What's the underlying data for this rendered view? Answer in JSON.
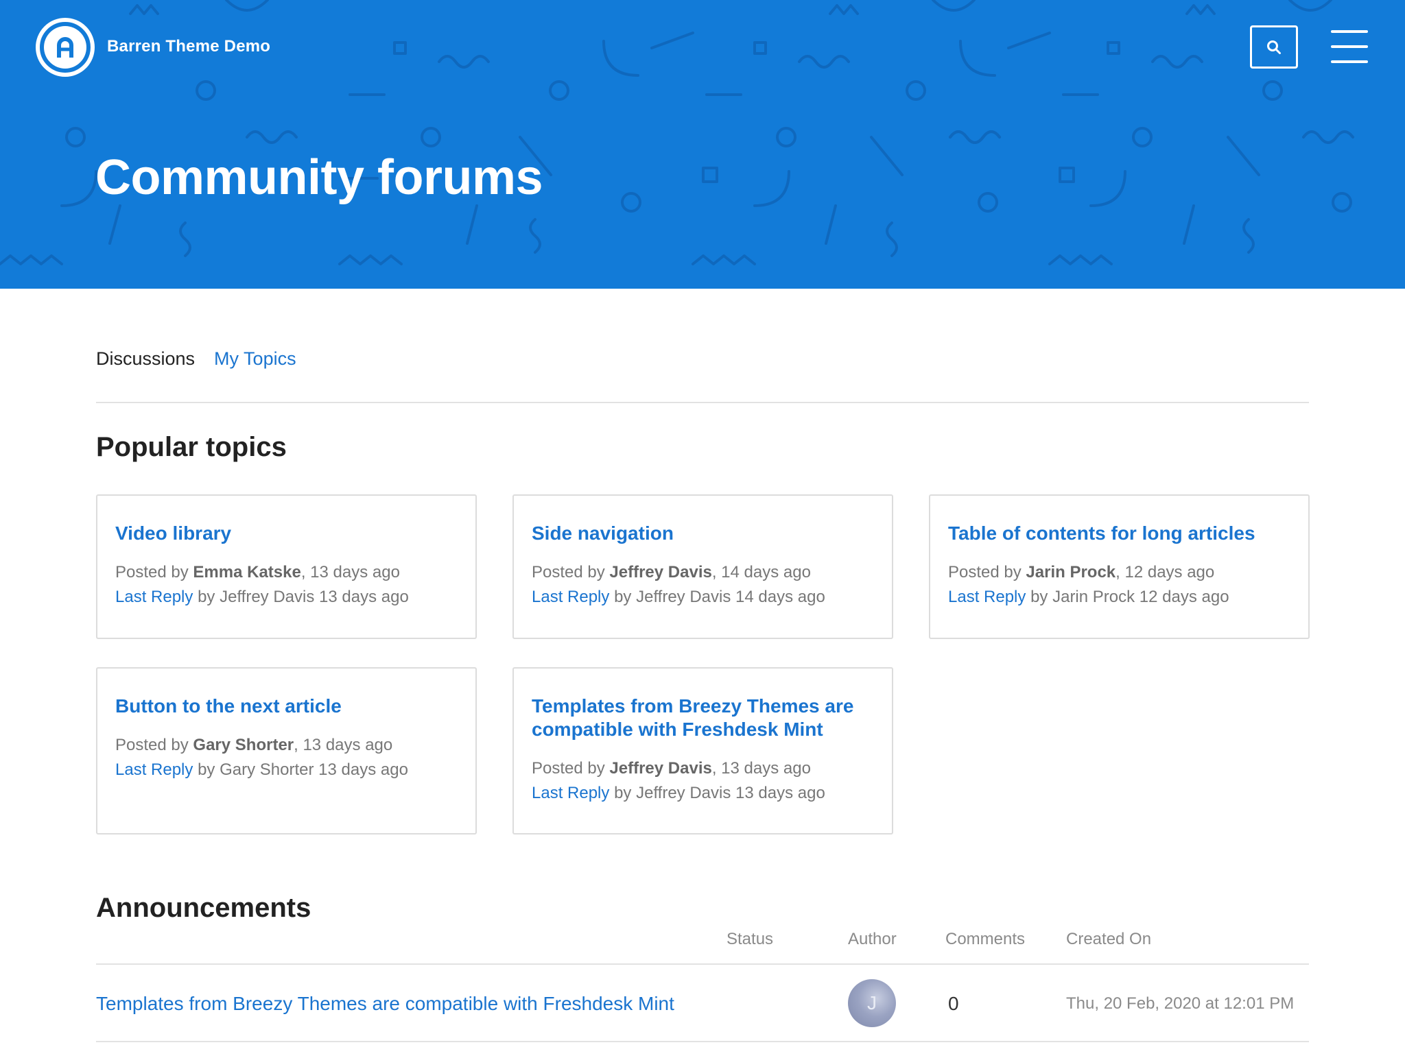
{
  "header": {
    "site_name": "Barren Theme Demo",
    "logo_letter": "A",
    "page_title": "Community forums",
    "search_icon": "search-icon",
    "menu_icon": "hamburger-menu-icon"
  },
  "tabs": {
    "discussions": "Discussions",
    "my_topics": "My Topics"
  },
  "popular": {
    "heading": "Popular topics",
    "posted_prefix": "Posted by",
    "last_reply_label": "Last Reply",
    "by_word": "by",
    "cards": [
      {
        "title": "Video library",
        "author": "Emma Katske",
        "posted_ago": ", 13 days ago",
        "reply_text": "Jeffrey Davis 13 days ago"
      },
      {
        "title": "Side navigation",
        "author": "Jeffrey Davis",
        "posted_ago": ", 14 days ago",
        "reply_text": "Jeffrey Davis 14 days ago"
      },
      {
        "title": "Table of contents for long articles",
        "author": "Jarin Prock",
        "posted_ago": ", 12 days ago",
        "reply_text": "Jarin Prock 12 days ago"
      },
      {
        "title": "Button to the next article",
        "author": "Gary Shorter",
        "posted_ago": ", 13 days ago",
        "reply_text": "Gary Shorter 13 days ago"
      },
      {
        "title": "Templates from Breezy Themes are compatible with Freshdesk Mint",
        "author": "Jeffrey Davis",
        "posted_ago": ", 13 days ago",
        "reply_text": "Jeffrey Davis 13 days ago"
      }
    ]
  },
  "announcements": {
    "heading": "Announcements",
    "columns": {
      "status": "Status",
      "author": "Author",
      "comments": "Comments",
      "created_on": "Created On"
    },
    "rows": [
      {
        "title": "Templates from Breezy Themes are compatible with Freshdesk Mint",
        "author_initial": "J",
        "comments": "0",
        "created_on": "Thu, 20 Feb, 2020 at 12:01 PM"
      }
    ]
  },
  "colors": {
    "brand_blue": "#127bd8",
    "link_blue": "#1a74cf"
  }
}
